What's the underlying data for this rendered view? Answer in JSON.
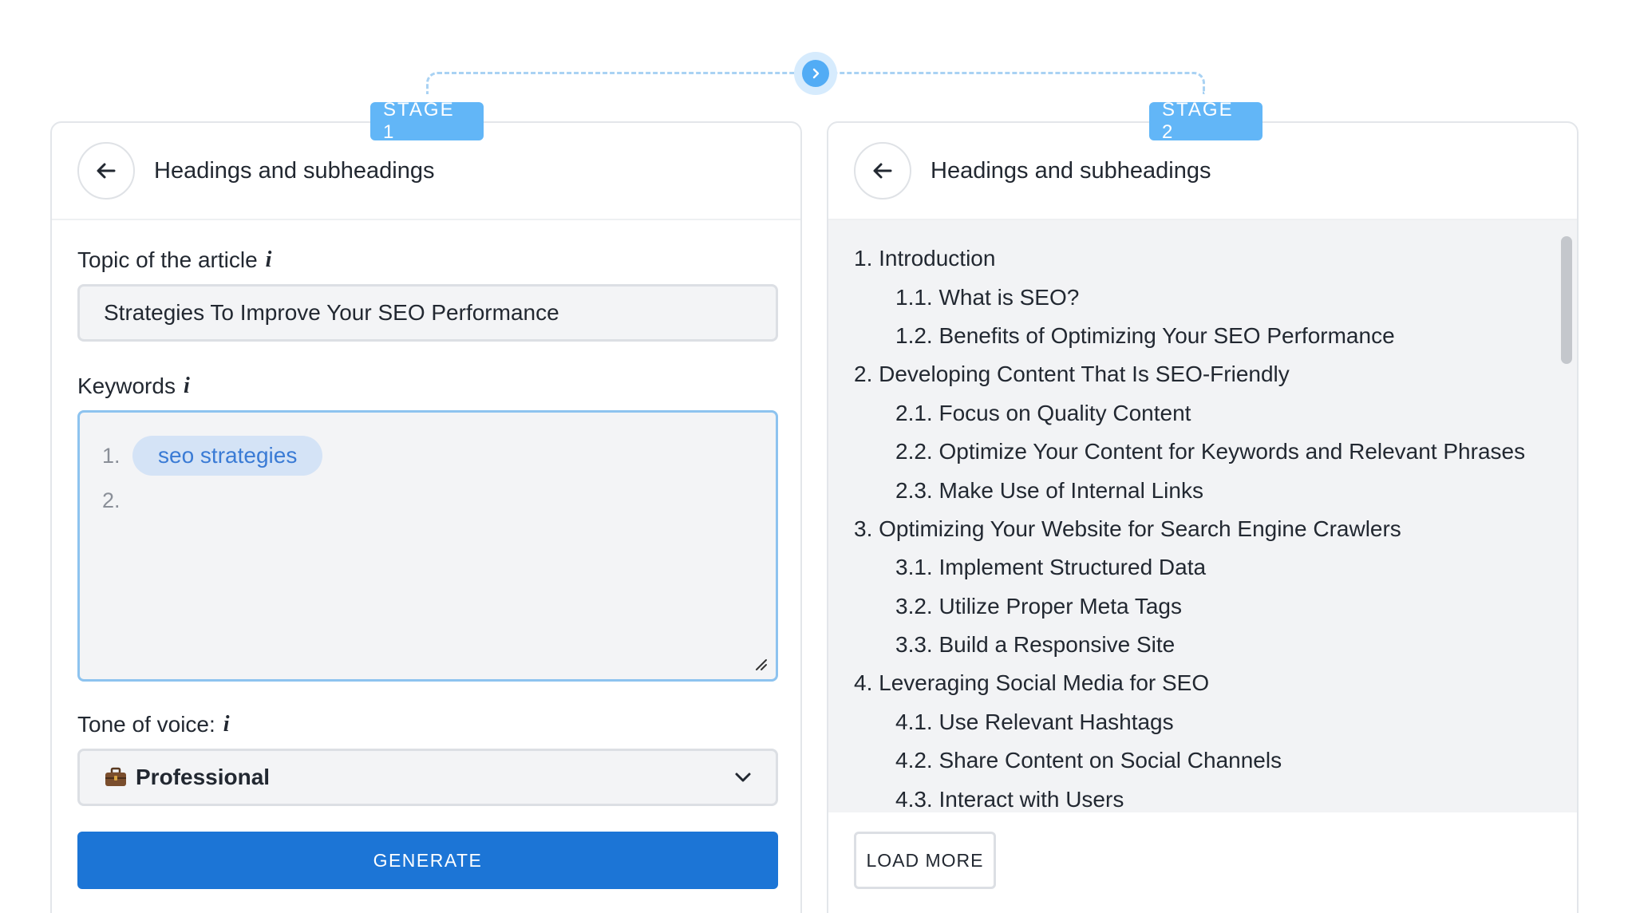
{
  "stages": [
    {
      "badge": "STAGE 1",
      "title": "Headings and subheadings"
    },
    {
      "badge": "STAGE 2",
      "title": "Headings and subheadings"
    }
  ],
  "form": {
    "topic_label": "Topic of the article",
    "topic_value": "Strategies To Improve Your SEO Performance",
    "keywords_label": "Keywords",
    "keywords": [
      {
        "num": "1.",
        "value": "seo strategies"
      },
      {
        "num": "2.",
        "value": ""
      }
    ],
    "tone_label": "Tone of voice:",
    "tone_value": "Professional",
    "info_glyph": "i",
    "generate_label": "GENERATE"
  },
  "outline": [
    {
      "text": "1. Introduction",
      "level": 1
    },
    {
      "text": "1.1. What is SEO?",
      "level": 2
    },
    {
      "text": "1.2. Benefits of Optimizing Your SEO Performance",
      "level": 2
    },
    {
      "text": "2. Developing Content That Is SEO-Friendly",
      "level": 1
    },
    {
      "text": "2.1. Focus on Quality Content",
      "level": 2
    },
    {
      "text": "2.2. Optimize Your Content for Keywords and Relevant Phrases",
      "level": 2
    },
    {
      "text": "2.3. Make Use of Internal Links",
      "level": 2
    },
    {
      "text": "3. Optimizing Your Website for Search Engine Crawlers",
      "level": 1
    },
    {
      "text": "3.1. Implement Structured Data",
      "level": 2
    },
    {
      "text": "3.2. Utilize Proper Meta Tags",
      "level": 2
    },
    {
      "text": "3.3. Build a Responsive Site",
      "level": 2
    },
    {
      "text": "4. Leveraging Social Media for SEO",
      "level": 1
    },
    {
      "text": "4.1. Use Relevant Hashtags",
      "level": 2
    },
    {
      "text": "4.2. Share Content on Social Channels",
      "level": 2
    },
    {
      "text": "4.3. Interact with Users",
      "level": 2
    }
  ],
  "load_more_label": "LOAD MORE",
  "colors": {
    "accent": "#1c75d6",
    "badge": "#62b6f7",
    "chip_bg": "#d4e3f6",
    "chip_text": "#3a7bd5"
  },
  "icons": {
    "next": "chevron-right-icon",
    "back": "arrow-left-icon",
    "tone": "briefcase-icon",
    "dropdown": "chevron-down-icon",
    "resize": "resize-handle-icon"
  }
}
